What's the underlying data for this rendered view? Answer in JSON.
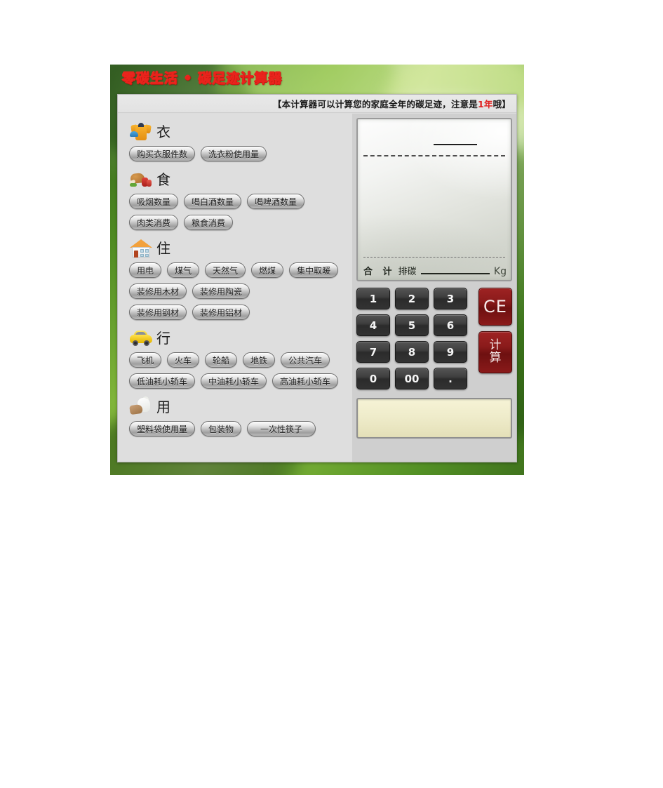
{
  "window": {
    "title": "零碳生活 • 碳足迹计算器",
    "notice_prefix": "【本计算器可以计算您的家庭全年的碳足迹，注意是",
    "notice_highlight": "1年",
    "notice_suffix": "哦】"
  },
  "colors": {
    "title_red": "#e8231c",
    "highlight_red": "#e02020",
    "key_dark": "#333333",
    "key_red": "#8b1b1b",
    "panel_gray": "#dedede",
    "output_cream": "#efeccb",
    "frame_green": "#4f8b22"
  },
  "sections": [
    {
      "id": "clothing",
      "title": "衣",
      "icon": "shirt-icon",
      "rows": [
        [
          {
            "label": "购买衣服件数"
          },
          {
            "label": "洗衣粉使用量"
          }
        ]
      ]
    },
    {
      "id": "food",
      "title": "食",
      "icon": "food-icon",
      "rows": [
        [
          {
            "label": "吸烟数量"
          },
          {
            "label": "喝白酒数量"
          },
          {
            "label": "喝啤酒数量"
          }
        ],
        [
          {
            "label": "肉类消费"
          },
          {
            "label": "粮食消费"
          }
        ]
      ]
    },
    {
      "id": "housing",
      "title": "住",
      "icon": "house-icon",
      "rows": [
        [
          {
            "label": "用电"
          },
          {
            "label": "煤气"
          },
          {
            "label": "天然气"
          },
          {
            "label": "燃煤"
          },
          {
            "label": "集中取暖"
          }
        ],
        [
          {
            "label": "装修用木材"
          },
          {
            "label": "装修用陶瓷"
          }
        ],
        [
          {
            "label": "装修用钢材"
          },
          {
            "label": "装修用铝材"
          }
        ]
      ]
    },
    {
      "id": "travel",
      "title": "行",
      "icon": "car-icon",
      "rows": [
        [
          {
            "label": "飞机"
          },
          {
            "label": "火车"
          },
          {
            "label": "轮船"
          },
          {
            "label": "地铁"
          },
          {
            "label": "公共汽车"
          }
        ],
        [
          {
            "label": "低油耗小轿车"
          },
          {
            "label": "中油耗小轿车"
          },
          {
            "label": "高油耗小轿车"
          }
        ]
      ]
    },
    {
      "id": "usage",
      "title": "用",
      "icon": "plastic-bag-icon",
      "rows": [
        [
          {
            "label": "塑料袋使用量"
          },
          {
            "label": "包装物"
          },
          {
            "label": "一次性筷子",
            "wide": true
          }
        ]
      ]
    }
  ],
  "display": {
    "entry_value": "",
    "total_label": "合 计",
    "emission_label": "排碳",
    "total_value": "",
    "unit": "Kg"
  },
  "keypad": {
    "keys": [
      {
        "label": "1"
      },
      {
        "label": "2"
      },
      {
        "label": "3"
      },
      {
        "label": "4"
      },
      {
        "label": "5"
      },
      {
        "label": "6"
      },
      {
        "label": "7"
      },
      {
        "label": "8"
      },
      {
        "label": "9"
      },
      {
        "label": "0"
      },
      {
        "label": "00"
      },
      {
        "label": "."
      }
    ],
    "clear_label": "CE",
    "calc_label_line1": "计",
    "calc_label_line2": "算"
  },
  "output": {
    "text": ""
  }
}
